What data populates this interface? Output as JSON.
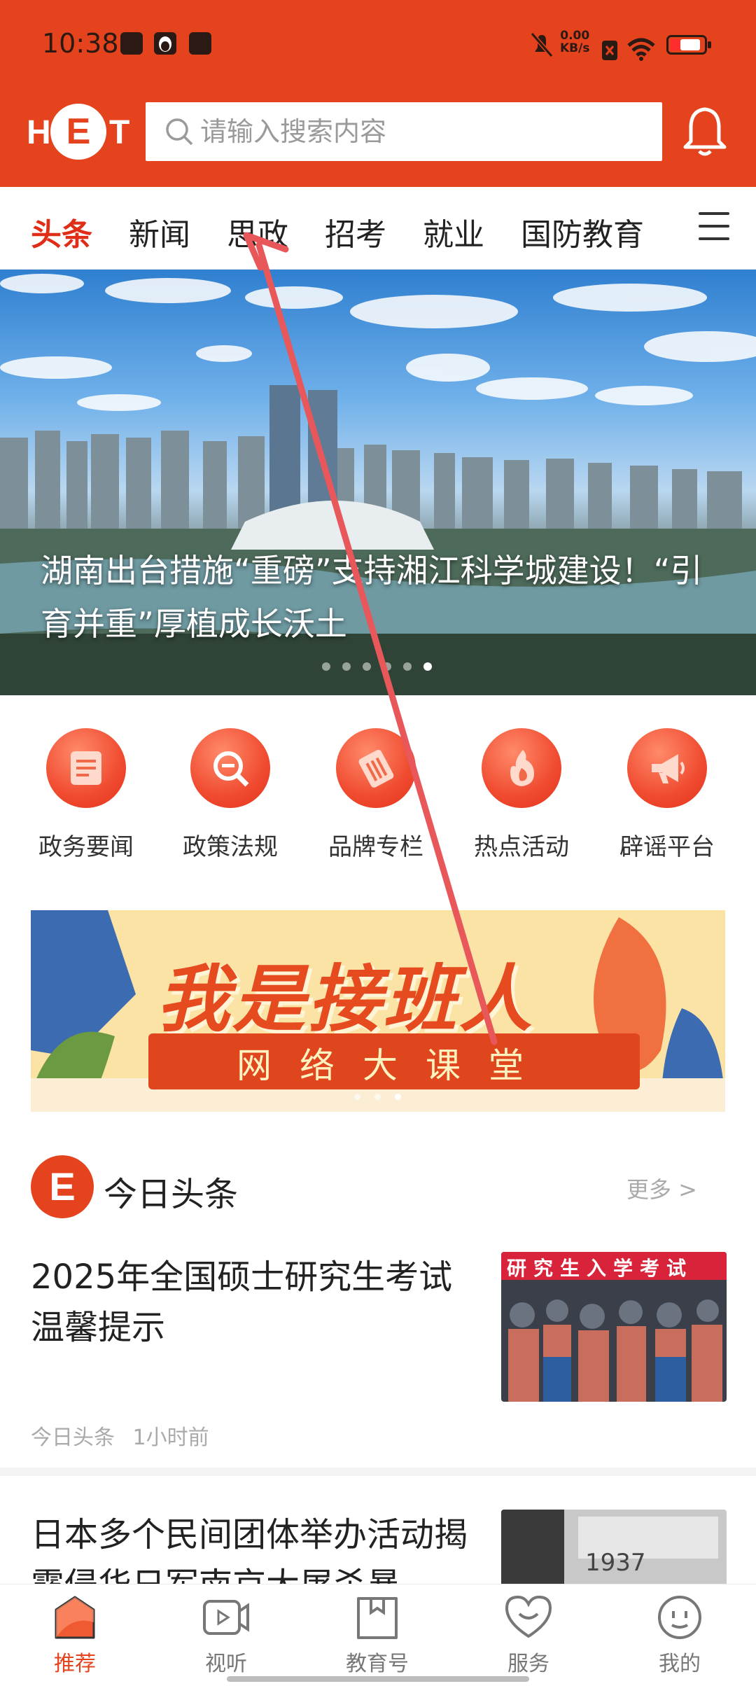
{
  "status_bar": {
    "time": "10:38",
    "net_speed_value": "0.00",
    "net_speed_unit": "KB/s"
  },
  "header": {
    "logo_left": "H",
    "logo_center": "E",
    "logo_right": "T",
    "search_placeholder": "请输入搜索内容"
  },
  "tabs": [
    {
      "label": "头条",
      "active": true
    },
    {
      "label": "新闻"
    },
    {
      "label": "思政"
    },
    {
      "label": "招考"
    },
    {
      "label": "就业"
    },
    {
      "label": "国防教育"
    }
  ],
  "hero": {
    "caption": "湖南出台措施“重磅”支持湘江科学城建设！“引育并重”厚植成长沃土",
    "slide_count": 6,
    "active_slide": 6
  },
  "quick_links": [
    {
      "label": "政务要闻",
      "icon": "document-icon"
    },
    {
      "label": "政策法规",
      "icon": "search-doc-icon"
    },
    {
      "label": "品牌专栏",
      "icon": "notebook-icon"
    },
    {
      "label": "热点活动",
      "icon": "flame-icon"
    },
    {
      "label": "辟谣平台",
      "icon": "megaphone-icon"
    }
  ],
  "banner": {
    "title": "我是接班人",
    "subtitle": "网络大课堂",
    "slide_count": 3,
    "active_slide": 3
  },
  "section": {
    "logo": "E",
    "title": "今日头条",
    "more": "更多 >"
  },
  "news": [
    {
      "title": "2025年全国硕士研究生考试温馨提示",
      "thumb_text": "研究生入学考试",
      "source": "今日头条",
      "time": "1小时前"
    },
    {
      "title": "日本多个民间团体举办活动揭露侵华日军南京大屠杀暴",
      "thumb_text": "1937"
    }
  ],
  "bottom_nav": [
    {
      "label": "推荐",
      "icon": "home-icon",
      "active": true
    },
    {
      "label": "视听",
      "icon": "video-icon"
    },
    {
      "label": "教育号",
      "icon": "book-icon"
    },
    {
      "label": "服务",
      "icon": "heart-face-icon"
    },
    {
      "label": "我的",
      "icon": "profile-face-icon"
    }
  ],
  "colors": {
    "brand": "#e5431d",
    "active_tab": "#e02d18",
    "arrow": "#e8575a"
  }
}
